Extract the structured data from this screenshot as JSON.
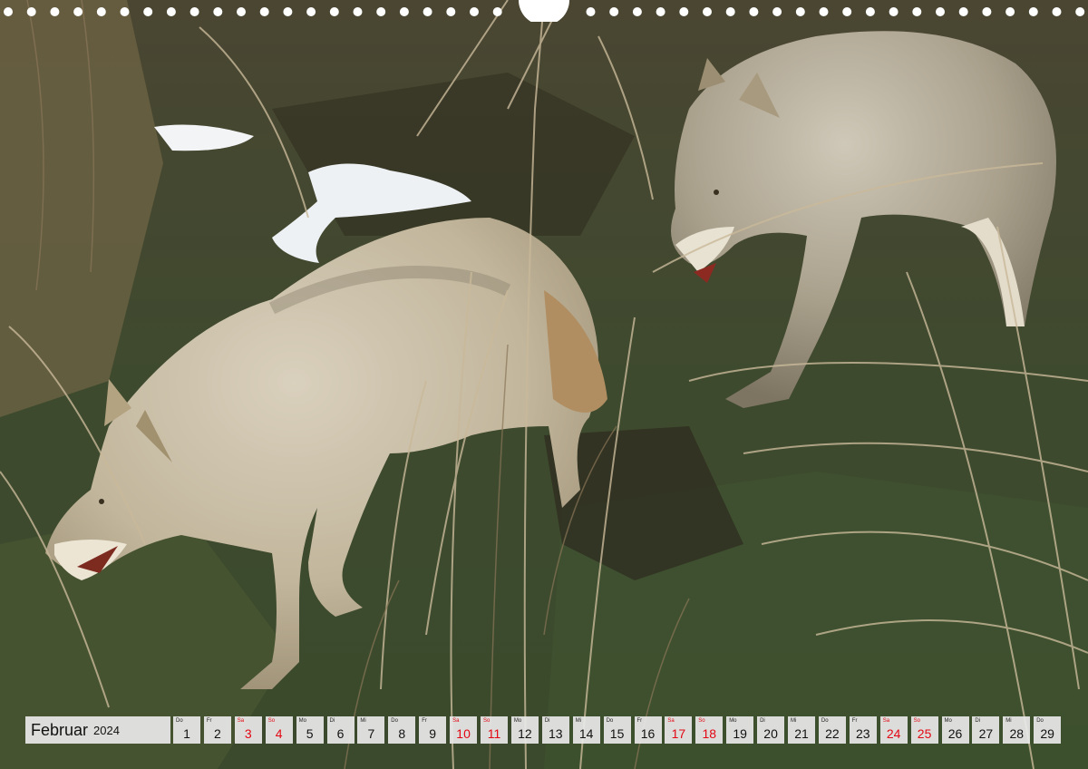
{
  "calendar": {
    "month": "Februar",
    "year": "2024",
    "weekend_color": "#e30613",
    "days": [
      {
        "wd": "Do",
        "num": "1",
        "weekend": false
      },
      {
        "wd": "Fr",
        "num": "2",
        "weekend": false
      },
      {
        "wd": "Sa",
        "num": "3",
        "weekend": true
      },
      {
        "wd": "So",
        "num": "4",
        "weekend": true
      },
      {
        "wd": "Mo",
        "num": "5",
        "weekend": false
      },
      {
        "wd": "Di",
        "num": "6",
        "weekend": false
      },
      {
        "wd": "Mi",
        "num": "7",
        "weekend": false
      },
      {
        "wd": "Do",
        "num": "8",
        "weekend": false
      },
      {
        "wd": "Fr",
        "num": "9",
        "weekend": false
      },
      {
        "wd": "Sa",
        "num": "10",
        "weekend": true
      },
      {
        "wd": "So",
        "num": "11",
        "weekend": true
      },
      {
        "wd": "Mo",
        "num": "12",
        "weekend": false
      },
      {
        "wd": "Di",
        "num": "13",
        "weekend": false
      },
      {
        "wd": "Mi",
        "num": "14",
        "weekend": false
      },
      {
        "wd": "Do",
        "num": "15",
        "weekend": false
      },
      {
        "wd": "Fr",
        "num": "16",
        "weekend": false
      },
      {
        "wd": "Sa",
        "num": "17",
        "weekend": true
      },
      {
        "wd": "So",
        "num": "18",
        "weekend": true
      },
      {
        "wd": "Mo",
        "num": "19",
        "weekend": false
      },
      {
        "wd": "Di",
        "num": "20",
        "weekend": false
      },
      {
        "wd": "Mi",
        "num": "21",
        "weekend": false
      },
      {
        "wd": "Do",
        "num": "22",
        "weekend": false
      },
      {
        "wd": "Fr",
        "num": "23",
        "weekend": false
      },
      {
        "wd": "Sa",
        "num": "24",
        "weekend": true
      },
      {
        "wd": "So",
        "num": "25",
        "weekend": true
      },
      {
        "wd": "Mo",
        "num": "26",
        "weekend": false
      },
      {
        "wd": "Di",
        "num": "27",
        "weekend": false
      },
      {
        "wd": "Mi",
        "num": "28",
        "weekend": false
      },
      {
        "wd": "Do",
        "num": "29",
        "weekend": false
      }
    ]
  }
}
